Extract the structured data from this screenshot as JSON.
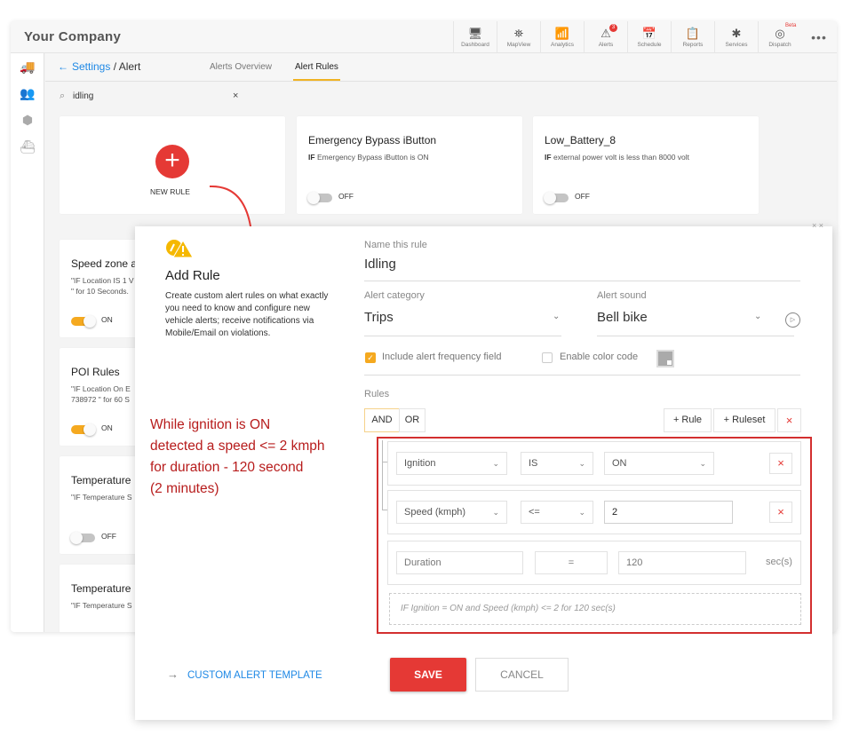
{
  "app": {
    "brand": "Your Company",
    "nav": [
      {
        "label": "Dashboard",
        "icon": "dashboard-icon",
        "glyph": "🖥"
      },
      {
        "label": "MapView",
        "icon": "map-pin-icon",
        "glyph": "⛯"
      },
      {
        "label": "Analytics",
        "icon": "analytics-icon",
        "glyph": "📶"
      },
      {
        "label": "Alerts",
        "icon": "alert-icon",
        "glyph": "⚠",
        "badge": "3"
      },
      {
        "label": "Schedule",
        "icon": "calendar-icon",
        "glyph": "📅"
      },
      {
        "label": "Reports",
        "icon": "report-icon",
        "glyph": "📋"
      },
      {
        "label": "Services",
        "icon": "tools-icon",
        "glyph": "✱"
      },
      {
        "label": "Dispatch",
        "icon": "dispatch-icon",
        "glyph": "◎",
        "tag": "Beta"
      }
    ],
    "more": "•••",
    "sidebar": [
      {
        "icon": "truck-icon",
        "glyph": "🚚"
      },
      {
        "icon": "users-icon",
        "glyph": "👥"
      },
      {
        "icon": "box-icon",
        "glyph": "⬢"
      },
      {
        "icon": "ship-icon",
        "glyph": "⛴"
      }
    ]
  },
  "subheader": {
    "back": "←",
    "crumb_link": "Settings",
    "crumb_sep": " / ",
    "crumb_current": "Alert",
    "tabs": [
      {
        "label": "Alerts Overview",
        "active": false
      },
      {
        "label": "Alert Rules",
        "active": true
      }
    ]
  },
  "search": {
    "icon": "⌕",
    "value": "idling",
    "clear": "×"
  },
  "new_rule": {
    "plus": "+",
    "label": "NEW RULE"
  },
  "cards": [
    {
      "title": "Emergency Bypass iButton",
      "if": "IF",
      "desc": "Emergency Bypass iButton is ON",
      "state": "OFF"
    },
    {
      "title": "Low_Battery_8",
      "if": "IF",
      "desc": "external power volt is less than 8000 volt",
      "state": "OFF"
    },
    {
      "title": "Speed zone a",
      "desc1": "\"IF Location IS 1 V",
      "desc2": "\" for 10 Seconds.",
      "state": "ON"
    },
    {
      "title": "POI Rules",
      "desc1": "\"IF Location On E",
      "desc2": "738972 \" for 60 S",
      "state": "ON"
    },
    {
      "title": "Temperature",
      "desc1": "\"IF Temperature S",
      "state": "OFF"
    },
    {
      "title": "Temperature",
      "desc1": "\"IF Temperature S"
    }
  ],
  "modal": {
    "close": "× ×",
    "intro_title": "Add Rule",
    "intro_desc": "Create custom alert rules on what exactly you need to know and configure new vehicle alerts; receive notifications via Mobile/Email on violations.",
    "name_label": "Name this rule",
    "name_value": "Idling",
    "category_label": "Alert category",
    "category_value": "Trips",
    "sound_label": "Alert sound",
    "sound_value": "Bell bike",
    "play": "▷",
    "chevron": "⌄",
    "include_frequency": {
      "label": "Include alert frequency field",
      "checked": true,
      "mark": "✓"
    },
    "enable_color": {
      "label": "Enable color code",
      "checked": false
    },
    "rules_label": "Rules",
    "and_label": "AND",
    "or_label": "OR",
    "add_rule": "+ Rule",
    "add_ruleset": "+ Ruleset",
    "remove": "×",
    "conditions": [
      {
        "field": "Ignition",
        "operator": "IS",
        "value": "ON"
      },
      {
        "field": "Speed (kmph)",
        "operator": "<=",
        "value": "2"
      }
    ],
    "duration": {
      "field": "Duration",
      "operator": "=",
      "value": "120",
      "units": "sec(s)"
    },
    "summary": "IF Ignition = ON and Speed (kmph) <= 2 for 120 sec(s)",
    "template_arrow": "→",
    "template_link": "CUSTOM ALERT TEMPLATE",
    "save": "SAVE",
    "cancel": "CANCEL"
  },
  "annotation": {
    "lines": [
      "While ignition is ON",
      "detected a speed <= 2 kmph",
      "for duration - 120 second",
      "(2 minutes)"
    ],
    "color": "#b71c1c"
  },
  "colors": {
    "accent": "#f5a91f",
    "danger": "#e53935",
    "link": "#1e88e5"
  }
}
